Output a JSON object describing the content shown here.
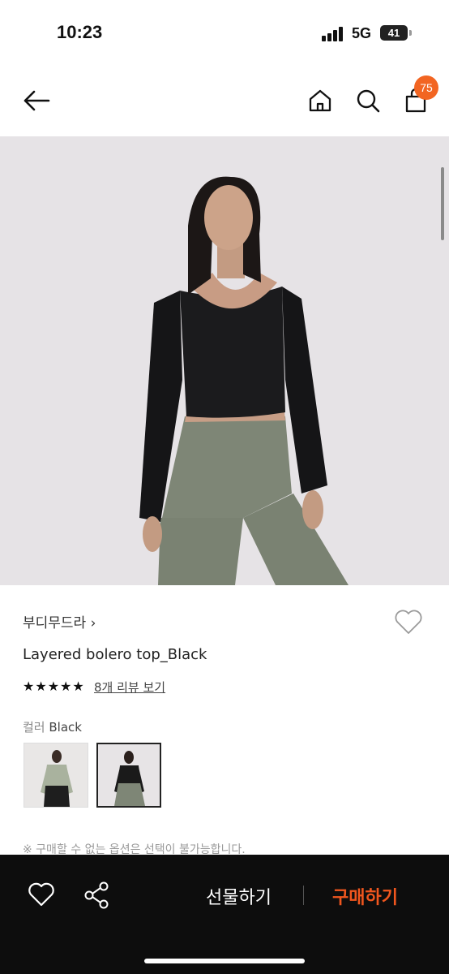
{
  "status_bar": {
    "time": "10:23",
    "network": "5G",
    "battery": "41"
  },
  "nav": {
    "cart_count": "75"
  },
  "product": {
    "brand": "부디무드라",
    "brand_chevron": "›",
    "name": "Layered bolero top_Black",
    "rating_stars": 5,
    "review_link": "8개 리뷰 보기",
    "color_label": "컬러",
    "color_value": "Black",
    "swatches": [
      "sage",
      "black"
    ],
    "notice": "※ 구매할 수 없는 옵션은 선택이 불가능합니다."
  },
  "bottom_bar": {
    "gift_label": "선물하기",
    "buy_label": "구매하기"
  },
  "colors": {
    "accent": "#f0561e",
    "badge": "#f26522",
    "bar": "#0d0d0d"
  }
}
